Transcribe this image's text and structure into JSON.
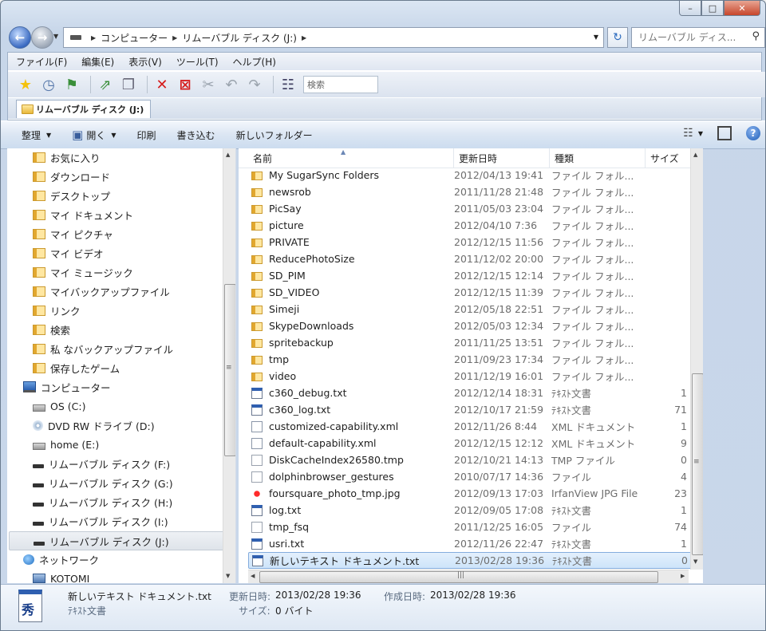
{
  "window": {
    "caption_buttons": {
      "minimize": "–",
      "maximize": "□",
      "close": "✕"
    }
  },
  "address": {
    "crumbs": [
      "コンピューター",
      "リムーバブル ディスク (J:)"
    ],
    "search_placeholder": "リムーバブル ディス..."
  },
  "menu": [
    "ファイル(F)",
    "編集(E)",
    "表示(V)",
    "ツール(T)",
    "ヘルプ(H)"
  ],
  "toolbar": {
    "search_label": "検索",
    "tab_label": "リムーバブル ディスク (J:)"
  },
  "commandbar": {
    "organize": "整理",
    "open": "開く",
    "print": "印刷",
    "burn": "書き込む",
    "new_folder": "新しいフォルダー"
  },
  "nav": {
    "items": [
      {
        "label": "お気に入り",
        "icon": "folder"
      },
      {
        "label": "ダウンロード",
        "icon": "folder"
      },
      {
        "label": "デスクトップ",
        "icon": "folder"
      },
      {
        "label": "マイ ドキュメント",
        "icon": "folder"
      },
      {
        "label": "マイ ピクチャ",
        "icon": "folder"
      },
      {
        "label": "マイ ビデオ",
        "icon": "folder"
      },
      {
        "label": "マイ ミュージック",
        "icon": "folder"
      },
      {
        "label": "マイバックアップファイル",
        "icon": "folder"
      },
      {
        "label": "リンク",
        "icon": "folder"
      },
      {
        "label": "検索",
        "icon": "folder"
      },
      {
        "label": "私 なバックアップファイル",
        "icon": "folder"
      },
      {
        "label": "保存したゲーム",
        "icon": "folder"
      },
      {
        "label": "コンピューター",
        "icon": "computer"
      },
      {
        "label": "OS (C:)",
        "icon": "drive"
      },
      {
        "label": "DVD RW ドライブ (D:)",
        "icon": "dvd"
      },
      {
        "label": "home (E:)",
        "icon": "drive"
      },
      {
        "label": "リムーバブル ディスク (F:)",
        "icon": "removable"
      },
      {
        "label": "リムーバブル ディスク (G:)",
        "icon": "removable"
      },
      {
        "label": "リムーバブル ディスク (H:)",
        "icon": "removable"
      },
      {
        "label": "リムーバブル ディスク (I:)",
        "icon": "removable"
      },
      {
        "label": "リムーバブル ディスク (J:)",
        "icon": "removable"
      },
      {
        "label": "ネットワーク",
        "icon": "network"
      },
      {
        "label": "KOTOMI",
        "icon": "pc"
      }
    ]
  },
  "columns": {
    "name": "名前",
    "date": "更新日時",
    "type": "種類",
    "size": "サイズ"
  },
  "files": [
    {
      "name": "My SugarSync Folders",
      "date": "2012/04/13 19:41",
      "type": "ファイル フォル...",
      "size": "",
      "icon": "folder"
    },
    {
      "name": "newsrob",
      "date": "2011/11/28 21:48",
      "type": "ファイル フォル...",
      "size": "",
      "icon": "folder"
    },
    {
      "name": "PicSay",
      "date": "2011/05/03 23:04",
      "type": "ファイル フォル...",
      "size": "",
      "icon": "folder"
    },
    {
      "name": "picture",
      "date": "2012/04/10 7:36",
      "type": "ファイル フォル...",
      "size": "",
      "icon": "folder"
    },
    {
      "name": "PRIVATE",
      "date": "2012/12/15 11:56",
      "type": "ファイル フォル...",
      "size": "",
      "icon": "folder"
    },
    {
      "name": "ReducePhotoSize",
      "date": "2011/12/02 20:00",
      "type": "ファイル フォル...",
      "size": "",
      "icon": "folder"
    },
    {
      "name": "SD_PIM",
      "date": "2012/12/15 12:14",
      "type": "ファイル フォル...",
      "size": "",
      "icon": "folder"
    },
    {
      "name": "SD_VIDEO",
      "date": "2012/12/15 11:39",
      "type": "ファイル フォル...",
      "size": "",
      "icon": "folder"
    },
    {
      "name": "Simeji",
      "date": "2012/05/18 22:51",
      "type": "ファイル フォル...",
      "size": "",
      "icon": "folder"
    },
    {
      "name": "SkypeDownloads",
      "date": "2012/05/03 12:34",
      "type": "ファイル フォル...",
      "size": "",
      "icon": "folder"
    },
    {
      "name": "spritebackup",
      "date": "2011/11/25 13:51",
      "type": "ファイル フォル...",
      "size": "",
      "icon": "folder"
    },
    {
      "name": "tmp",
      "date": "2011/09/23 17:34",
      "type": "ファイル フォル...",
      "size": "",
      "icon": "folder"
    },
    {
      "name": "video",
      "date": "2011/12/19 16:01",
      "type": "ファイル フォル...",
      "size": "",
      "icon": "folder"
    },
    {
      "name": "c360_debug.txt",
      "date": "2012/12/14 18:31",
      "type": "ﾃｷｽﾄ文書",
      "size": "1",
      "icon": "txt"
    },
    {
      "name": "c360_log.txt",
      "date": "2012/10/17 21:59",
      "type": "ﾃｷｽﾄ文書",
      "size": "71",
      "icon": "txt"
    },
    {
      "name": "customized-capability.xml",
      "date": "2012/11/26 8:44",
      "type": "XML ドキュメント",
      "size": "1",
      "icon": "xml"
    },
    {
      "name": "default-capability.xml",
      "date": "2012/12/15 12:12",
      "type": "XML ドキュメント",
      "size": "9",
      "icon": "xml"
    },
    {
      "name": "DiskCacheIndex26580.tmp",
      "date": "2012/10/21 14:13",
      "type": "TMP ファイル",
      "size": "0",
      "icon": "blank"
    },
    {
      "name": "dolphinbrowser_gestures",
      "date": "2010/07/17 14:36",
      "type": "ファイル",
      "size": "4",
      "icon": "blank"
    },
    {
      "name": "foursquare_photo_tmp.jpg",
      "date": "2012/09/13 17:03",
      "type": "IrfanView JPG File",
      "size": "23",
      "icon": "jpg"
    },
    {
      "name": "log.txt",
      "date": "2012/09/05 17:08",
      "type": "ﾃｷｽﾄ文書",
      "size": "1",
      "icon": "txt"
    },
    {
      "name": "tmp_fsq",
      "date": "2011/12/25 16:05",
      "type": "ファイル",
      "size": "74",
      "icon": "blank"
    },
    {
      "name": "usri.txt",
      "date": "2012/11/26 22:47",
      "type": "ﾃｷｽﾄ文書",
      "size": "1",
      "icon": "txt"
    },
    {
      "name": "新しいテキスト ドキュメント.txt",
      "date": "2013/02/28 19:36",
      "type": "ﾃｷｽﾄ文書",
      "size": "0",
      "icon": "txt",
      "selected": true
    }
  ],
  "details": {
    "icon_glyph": "秀",
    "filename": "新しいテキスト ドキュメント.txt",
    "filetype": "ﾃｷｽﾄ文書",
    "modified_label": "更新日時:",
    "modified": "2013/02/28 19:36",
    "created_label": "作成日時:",
    "created": "2013/02/28 19:36",
    "size_label": "サイズ:",
    "size": "0 バイト"
  }
}
